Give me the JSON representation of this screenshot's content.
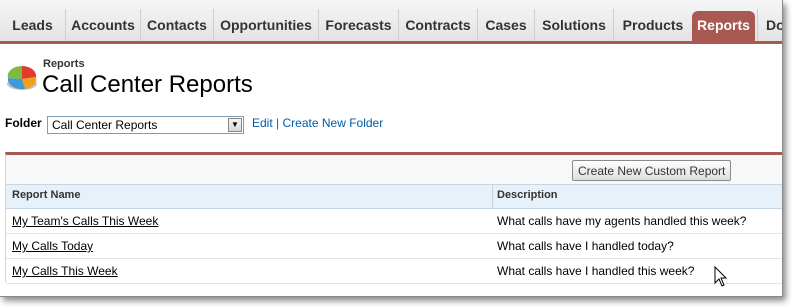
{
  "tabs": [
    {
      "label": "Leads",
      "active": false
    },
    {
      "label": "Accounts",
      "active": false
    },
    {
      "label": "Contacts",
      "active": false
    },
    {
      "label": "Opportunities",
      "active": false
    },
    {
      "label": "Forecasts",
      "active": false
    },
    {
      "label": "Contracts",
      "active": false
    },
    {
      "label": "Cases",
      "active": false
    },
    {
      "label": "Solutions",
      "active": false
    },
    {
      "label": "Products",
      "active": false
    },
    {
      "label": "Reports",
      "active": true
    },
    {
      "label": "Do",
      "active": false
    }
  ],
  "header": {
    "breadcrumb": "Reports",
    "title": "Call Center Reports",
    "icon": "pie-chart-icon"
  },
  "folder": {
    "label": "Folder",
    "selected": "Call Center Reports",
    "edit_label": "Edit",
    "separator": "|",
    "create_folder_label": "Create New Folder"
  },
  "panel": {
    "new_report_button": "Create New Custom Report",
    "columns": [
      "Report Name",
      "Description"
    ],
    "rows": [
      {
        "name": "My Team's Calls This Week",
        "description": "What calls have my agents handled this week?"
      },
      {
        "name": "My Calls Today",
        "description": "What calls have I handled today?"
      },
      {
        "name": "My Calls This Week",
        "description": "What calls have I handled this week?"
      }
    ]
  },
  "colors": {
    "accent": "#a85a52",
    "link": "#015ba7",
    "table_header": "#e7f1fa"
  }
}
